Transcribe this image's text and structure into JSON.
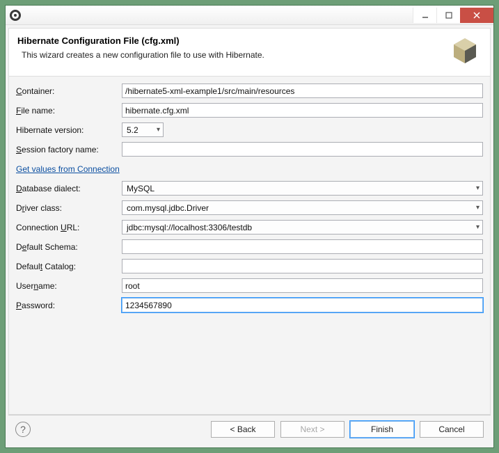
{
  "window": {
    "title": ""
  },
  "header": {
    "title": "Hibernate Configuration File (cfg.xml)",
    "subtitle": "This wizard creates a new configuration file to use with Hibernate."
  },
  "labels": {
    "container": "Container:",
    "filename": "File name:",
    "hibernate_version": "Hibernate version:",
    "session_factory": "Session factory name:",
    "get_values_link": "Get values from Connection",
    "db_dialect": "Database dialect:",
    "driver_class": "Driver class:",
    "connection_url": "Connection URL:",
    "default_schema": "Default Schema:",
    "default_catalog": "Default Catalog:",
    "username": "Username:",
    "password": "Password:"
  },
  "fields": {
    "container": "/hibernate5-xml-example1/src/main/resources",
    "filename": "hibernate.cfg.xml",
    "hibernate_version": "5.2",
    "session_factory": "",
    "db_dialect": "MySQL",
    "driver_class": "com.mysql.jdbc.Driver",
    "connection_url": "jdbc:mysql://localhost:3306/testdb",
    "default_schema": "",
    "default_catalog": "",
    "username": "root",
    "password": "1234567890"
  },
  "buttons": {
    "back": "< Back",
    "next": "Next >",
    "finish": "Finish",
    "cancel": "Cancel"
  }
}
